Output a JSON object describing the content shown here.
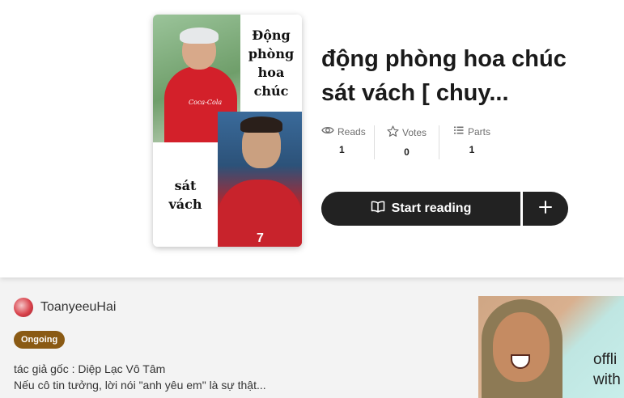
{
  "story": {
    "cover_text_top": "Động\nphòng\nhoa\nchúc",
    "cover_text_bottom": "sát\nvách",
    "cover_shirt_logo": "Coca-Cola",
    "cover_number": "7",
    "title": "động phòng hoa chúc sát vách [ chuy...",
    "stats": [
      {
        "label": "Reads",
        "value": "1",
        "icon": "eye-icon"
      },
      {
        "label": "Votes",
        "value": "0",
        "icon": "star-icon"
      },
      {
        "label": "Parts",
        "value": "1",
        "icon": "list-icon"
      }
    ],
    "start_reading_label": "Start reading"
  },
  "author": {
    "name": "ToanyeeuHai"
  },
  "status_badge": "Ongoing",
  "description": {
    "line1": "tác giả  gốc : Diệp Lạc Vô Tâm",
    "line2": "Nếu cô tin tưởng, lời nói \"anh yêu em\" là sự thật..."
  },
  "ad": {
    "text": "offli\nwith"
  },
  "colors": {
    "button_bg": "#222222",
    "badge_bg": "#8a5a14"
  }
}
